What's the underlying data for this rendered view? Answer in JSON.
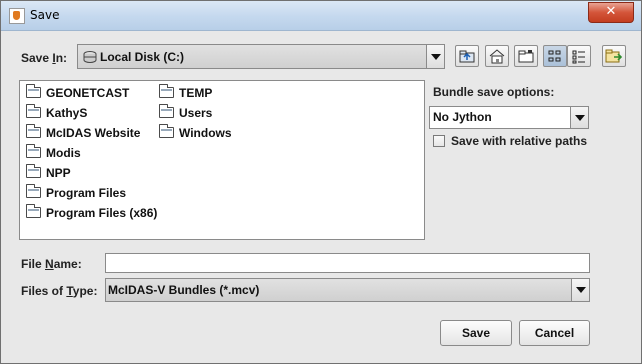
{
  "window": {
    "title": "Save",
    "close_symbol": "✕"
  },
  "save_in": {
    "label_prefix": "Save ",
    "label_mnemonic": "I",
    "label_suffix": "n:",
    "value": "Local Disk (C:)"
  },
  "toolbar": {
    "buttons": [
      "up-one-level",
      "home",
      "new-folder",
      "list-view",
      "details-view"
    ],
    "extra_button": "go-to-folder"
  },
  "files": [
    "GEONETCAST",
    "KathyS",
    "McIDAS Website",
    "Modis",
    "NPP",
    "Program Files",
    "Program Files (x86)",
    "TEMP",
    "Users",
    "Windows"
  ],
  "bundle": {
    "label": "Bundle save options:",
    "value": "No Jython",
    "checkbox_label": "Save with relative paths"
  },
  "file_name": {
    "label_prefix": "File ",
    "label_mnemonic": "N",
    "label_suffix": "ame:",
    "value": ""
  },
  "file_type": {
    "label_prefix": "Files of ",
    "label_mnemonic": "T",
    "label_suffix": "ype:",
    "value": "McIDAS-V Bundles (*.mcv)"
  },
  "actions": {
    "save": "Save",
    "cancel": "Cancel"
  }
}
